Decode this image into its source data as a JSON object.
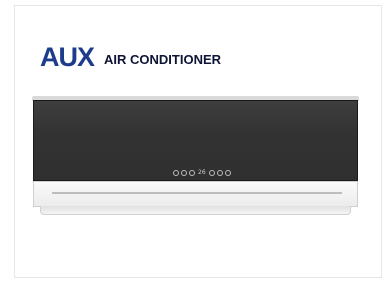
{
  "brand": {
    "logo": "AUX",
    "tagline": "AIR CONDITIONER"
  },
  "display": {
    "temperature": "26"
  },
  "colors": {
    "brand_blue": "#1d3c8c",
    "panel_dark": "#333333",
    "body_white": "#f5f5f5"
  }
}
